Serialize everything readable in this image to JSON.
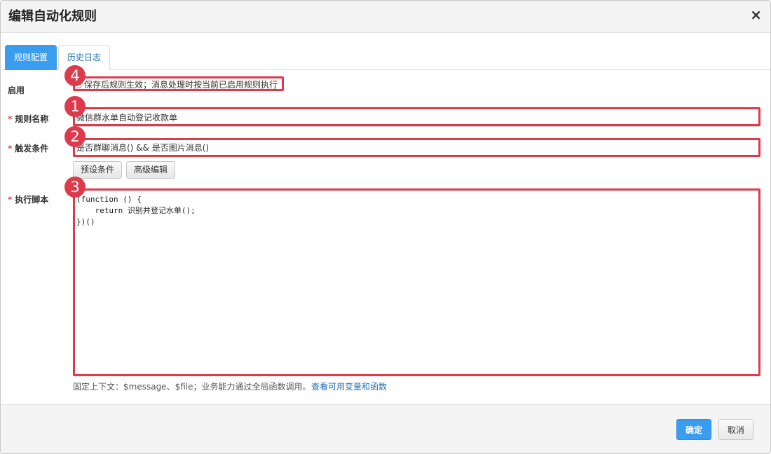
{
  "dialog": {
    "title": "编辑自动化规则",
    "close_icon": "×"
  },
  "tabs": [
    {
      "label": "规则配置",
      "active": true
    },
    {
      "label": "历史日志",
      "active": false
    }
  ],
  "form": {
    "enable": {
      "label": "启用",
      "checkbox_text": "保存后规则生效；消息处理时按当前已启用规则执行",
      "checked": false
    },
    "rule_name": {
      "required_mark": "*",
      "label": "规则名称",
      "value": "微信群水单自动登记收款单"
    },
    "trigger": {
      "required_mark": "*",
      "label": "触发条件",
      "value": "是否群聊消息() && 是否图片消息()",
      "preset_button": "预设条件",
      "advanced_button": "高级编辑"
    },
    "script": {
      "required_mark": "*",
      "label": "执行脚本",
      "value": "(function () {\n    return 识别并登记水单();\n})()",
      "hint": "固定上下文：$message、$file；业务能力通过全局函数调用。",
      "link": "查看可用变量和函数"
    }
  },
  "footer": {
    "ok_label": "确定",
    "cancel_label": "取消"
  },
  "annotations": {
    "badge_1": "1",
    "badge_2": "2",
    "badge_3": "3",
    "badge_4": "4",
    "color": "#dd3a4c"
  },
  "colors": {
    "primary": "#3b9df0",
    "link": "#1f6fb5",
    "required": "#d9534f"
  }
}
